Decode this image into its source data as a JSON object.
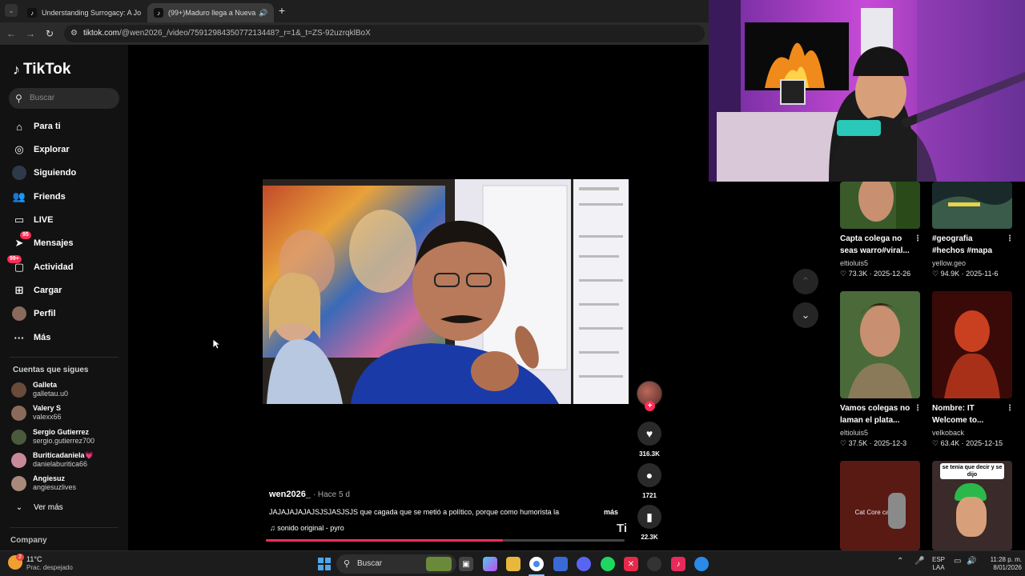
{
  "browser": {
    "tabs": [
      {
        "title": "Understanding Surrogacy: A Jo",
        "icon": "tiktok-icon"
      },
      {
        "title": "(99+)Maduro llega a Nueva",
        "icon": "tiktok-icon",
        "active": true
      }
    ],
    "url_host": "tiktok.com",
    "url_path": "/@wen2026_/video/7591298435077213448?_r=1&_t=ZS-92uzrqklBoX"
  },
  "sidebar": {
    "brand": "TikTok",
    "search_placeholder": "Buscar",
    "nav": [
      {
        "label": "Para ti",
        "icon": "home-icon"
      },
      {
        "label": "Explorar",
        "icon": "compass-icon"
      },
      {
        "label": "Siguiendo",
        "icon": "following-icon"
      },
      {
        "label": "Friends",
        "icon": "friends-icon"
      },
      {
        "label": "LIVE",
        "icon": "live-icon"
      },
      {
        "label": "Mensajes",
        "icon": "messages-icon",
        "badge": "95"
      },
      {
        "label": "Actividad",
        "icon": "activity-icon",
        "badge": "99+"
      },
      {
        "label": "Cargar",
        "icon": "upload-icon"
      },
      {
        "label": "Perfil",
        "icon": "profile-icon"
      },
      {
        "label": "Más",
        "icon": "more-icon"
      }
    ],
    "following_title": "Cuentas que sigues",
    "following": [
      {
        "name": "Galleta",
        "user": "galletau.u0"
      },
      {
        "name": "Valery S",
        "user": "valexx66"
      },
      {
        "name": "Sergio Gutierrez",
        "user": "sergio.gutierrez700"
      },
      {
        "name": "Buriticadaniela💗",
        "user": "danielaburitica66"
      },
      {
        "name": "Angiesuz",
        "user": "angiesuzlives"
      }
    ],
    "see_more": "Ver más",
    "company": "Company"
  },
  "video": {
    "author": "wen2026_",
    "ago": " · Hace 5 d",
    "description": "JAJAJAJAJAJSJSJASJSJS que cagada que se metió a político, porque como humorista la",
    "more": "más",
    "sound": "♫  sonido original - pyro",
    "watermark": "Ti",
    "likes": "316.3K",
    "comments": "1721",
    "saves": "22.3K",
    "progress": 0.66
  },
  "recommendations": [
    {
      "title1": "Capta colega no",
      "title2": "seas warro#viral...",
      "author": "eltioluis5",
      "likes": "73.3K",
      "date": "2025-12-26"
    },
    {
      "title1": "#geografia",
      "title2": "#hechos #mapa",
      "author": "yellow.geo",
      "likes": "94.9K",
      "date": "2025-11-6"
    },
    {
      "title1": "Vamos colegas no",
      "title2": "laman el plata...",
      "author": "eltioluis5",
      "likes": "37.5K",
      "date": "2025-12-3"
    },
    {
      "title1": "Nombre: IT",
      "title2": "Welcome to...",
      "author": "velkoback",
      "likes": "63.4K",
      "date": "2025-12-15"
    },
    {
      "thumb_text": "Cat Core cat core"
    },
    {
      "thumb_text": "se tenia que decir y se dijo"
    }
  ],
  "taskbar": {
    "weather_temp": "11°C",
    "weather_desc": "Prac. despejado",
    "weather_badge": "2",
    "search": "Buscar",
    "lang1": "ESP",
    "lang2": "LAA",
    "time": "11:28 p. m.",
    "date": "8/01/2026"
  },
  "colors": {
    "accent": "#fe2c55",
    "background": "#000000",
    "sidebar": "#121212"
  }
}
